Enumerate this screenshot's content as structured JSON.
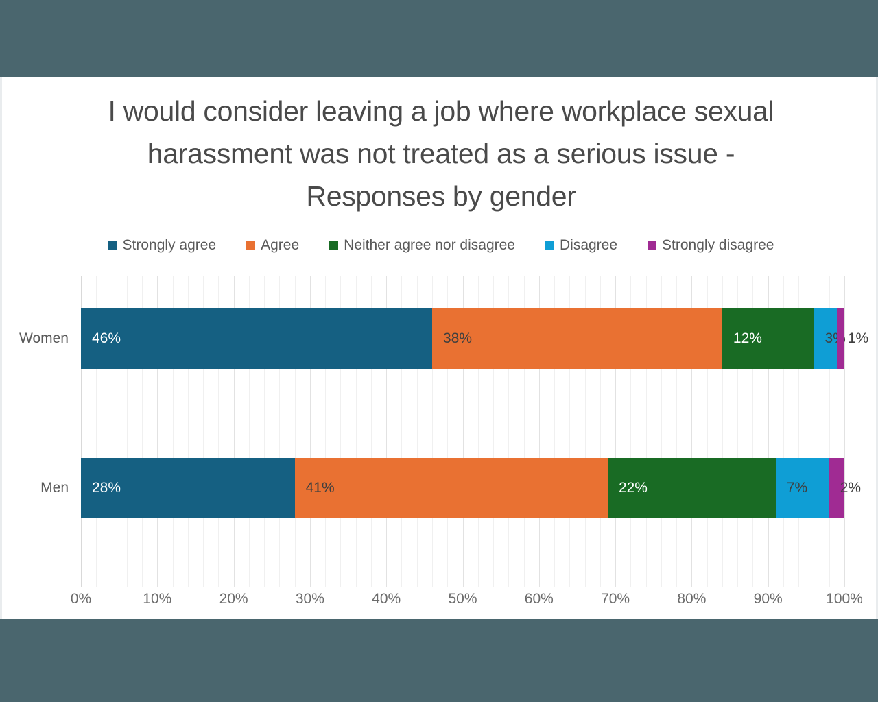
{
  "slide": {
    "background_color": "#ffffff",
    "frame_color": "#4a666e"
  },
  "chart_data": {
    "type": "bar",
    "orientation": "horizontal",
    "stacked": true,
    "stack_mode": "percent",
    "title": "I would consider leaving a job where workplace sexual harassment was not treated as a serious issue - Responses by gender",
    "xlabel": "",
    "ylabel": "",
    "xlim": [
      0,
      100
    ],
    "xticks": [
      0,
      10,
      20,
      30,
      40,
      50,
      60,
      70,
      80,
      90,
      100
    ],
    "xtick_labels": [
      "0%",
      "10%",
      "20%",
      "30%",
      "40%",
      "50%",
      "60%",
      "70%",
      "80%",
      "90%",
      "100%"
    ],
    "grid": true,
    "grid_axis": "x",
    "minor_grid_step": 2,
    "legend_position": "top",
    "categories": [
      "Women",
      "Men"
    ],
    "series": [
      {
        "name": "Strongly agree",
        "color": "#156082",
        "values": [
          46,
          28
        ],
        "labels": [
          "46%",
          "28%"
        ],
        "label_color": "light"
      },
      {
        "name": "Agree",
        "color": "#e97132",
        "values": [
          38,
          41
        ],
        "labels": [
          "38%",
          "41%"
        ],
        "label_color": "dark"
      },
      {
        "name": "Neither agree nor disagree",
        "color": "#196b24",
        "values": [
          12,
          22
        ],
        "labels": [
          "12%",
          "22%"
        ],
        "label_color": "light"
      },
      {
        "name": "Disagree",
        "color": "#0f9ed5",
        "values": [
          3,
          7
        ],
        "labels": [
          "3%",
          "7%"
        ],
        "label_color": "dark"
      },
      {
        "name": "Strongly disagree",
        "color": "#a02b93",
        "values": [
          1,
          2
        ],
        "labels": [
          "1%",
          "2%"
        ],
        "label_color": "dark"
      }
    ]
  }
}
